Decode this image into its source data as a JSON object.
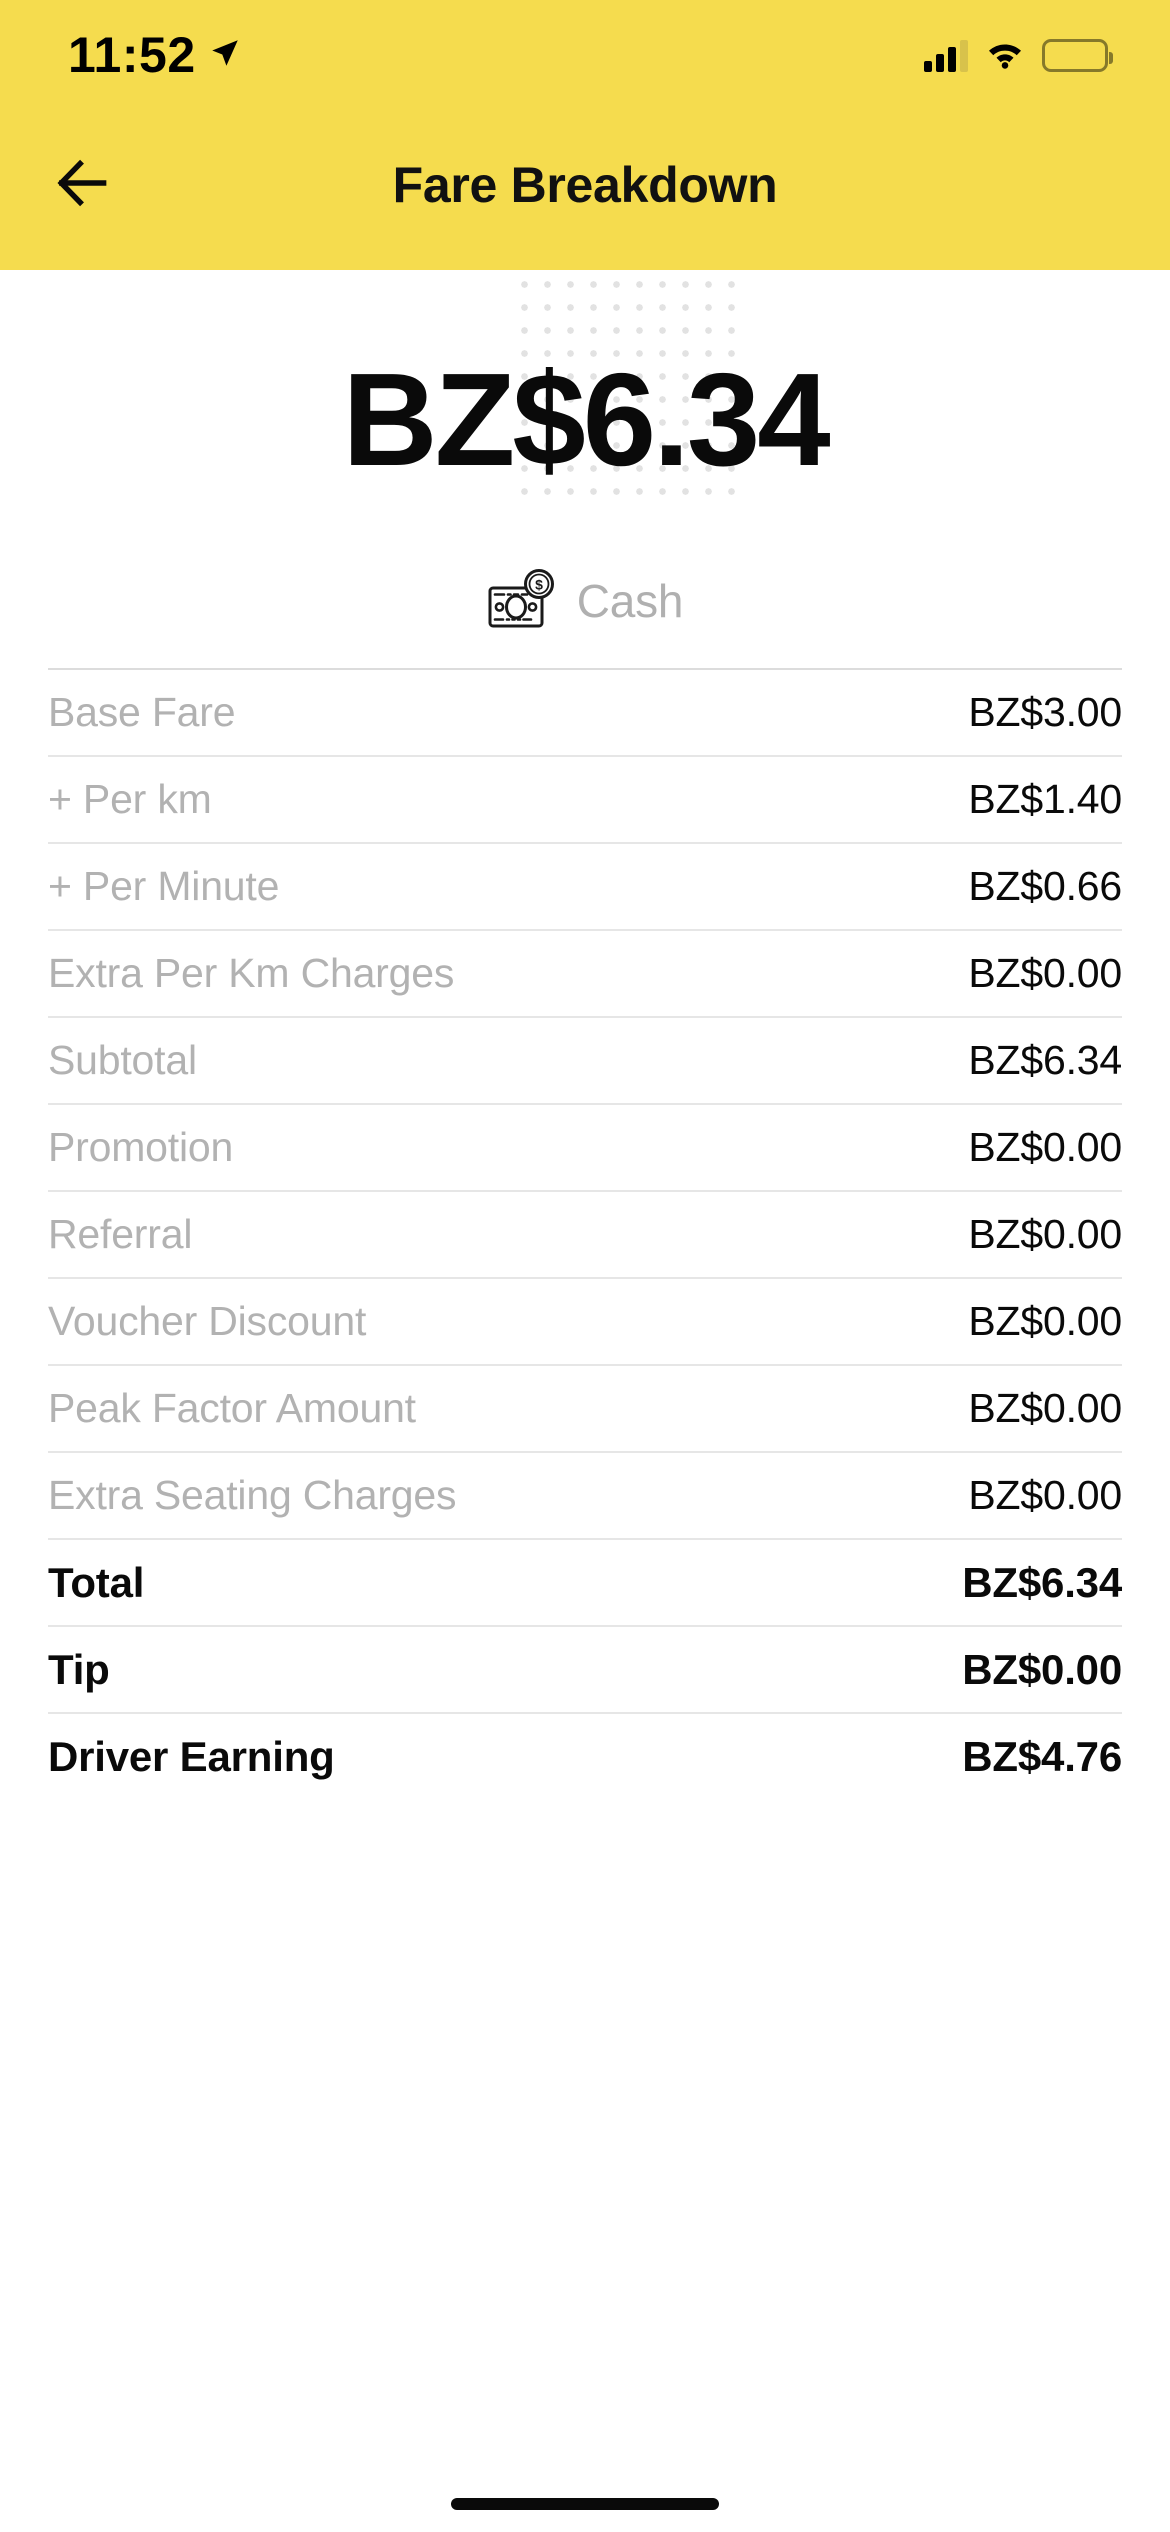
{
  "status_bar": {
    "time": "11:52",
    "location_icon": "location-arrow-icon",
    "signal_icon": "cellular-signal-icon",
    "wifi_icon": "wifi-icon",
    "battery_icon": "battery-icon"
  },
  "header": {
    "title": "Fare Breakdown",
    "back_icon": "back-arrow-icon",
    "background_color": "#F5DC4E"
  },
  "summary": {
    "total_amount": "BZ$6.34",
    "payment_method": "Cash",
    "payment_icon": "cash-banknote-coin-icon"
  },
  "fare_table": {
    "rows": [
      {
        "label": "Base Fare",
        "value": "BZ$3.00",
        "emphasis": false
      },
      {
        "label": "+ Per km",
        "value": "BZ$1.40",
        "emphasis": false
      },
      {
        "label": "+ Per Minute",
        "value": "BZ$0.66",
        "emphasis": false
      },
      {
        "label": "Extra Per Km Charges",
        "value": "BZ$0.00",
        "emphasis": false
      },
      {
        "label": "Subtotal",
        "value": "BZ$6.34",
        "emphasis": false
      },
      {
        "label": "Promotion",
        "value": "BZ$0.00",
        "emphasis": false
      },
      {
        "label": "Referral",
        "value": "BZ$0.00",
        "emphasis": false
      },
      {
        "label": "Voucher Discount",
        "value": "BZ$0.00",
        "emphasis": false
      },
      {
        "label": "Peak Factor Amount",
        "value": "BZ$0.00",
        "emphasis": false
      },
      {
        "label": "Extra Seating Charges",
        "value": "BZ$0.00",
        "emphasis": false
      },
      {
        "label": "Total",
        "value": "BZ$6.34",
        "emphasis": true
      },
      {
        "label": "Tip",
        "value": "BZ$0.00",
        "emphasis": true
      },
      {
        "label": "Driver Earning",
        "value": "BZ$4.76",
        "emphasis": true
      }
    ]
  },
  "colors": {
    "brand_yellow": "#F5DC4E",
    "label_gray": "#B2B2B2",
    "value_black": "#0A0A0A",
    "divider": "#E6E6E6"
  }
}
